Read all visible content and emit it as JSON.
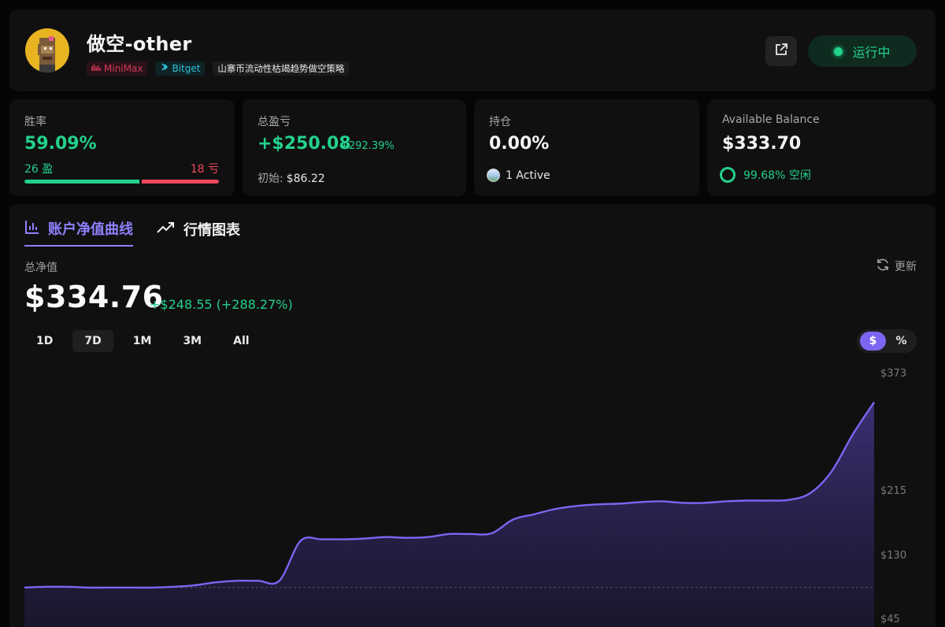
{
  "header": {
    "bot_name": "做空-other",
    "tags": {
      "model": "MiniMax",
      "exchange": "Bitget",
      "strategy": "山寨币流动性枯竭趋势做空策略"
    },
    "status_label": "运行中",
    "accent_green": "#23d18b"
  },
  "stats": {
    "winrate": {
      "label": "胜率",
      "value": "59.09%",
      "wins_label": "26 盈",
      "losses_label": "18 亏",
      "win_fraction": 0.5909
    },
    "pnl": {
      "label": "总盈亏",
      "value": "+$250.08",
      "pct": "+292.39%",
      "initial_label": "初始:",
      "initial_value": "$86.22"
    },
    "position": {
      "label": "持仓",
      "value": "0.00%",
      "active_label": "1 Active"
    },
    "balance": {
      "label": "Available Balance",
      "value": "$333.70",
      "idle_label": "99.68% 空闲"
    }
  },
  "main": {
    "tabs": [
      "账户净值曲线",
      "行情图表"
    ],
    "nav_label": "总净值",
    "refresh_label": "更新",
    "total_value": "$334.76",
    "change": "+$248.55 (+288.27%)",
    "ranges": [
      "1D",
      "7D",
      "1M",
      "3M",
      "All"
    ],
    "selected_range": "7D",
    "unit_toggle": [
      "$",
      "%"
    ],
    "unit_selected": "$",
    "accent_purple": "#7b66f2"
  },
  "chart_data": {
    "type": "area",
    "y_ticks": [
      "$373",
      "$215",
      "$130",
      "$45"
    ],
    "y_tick_values": [
      373,
      215,
      130,
      45
    ],
    "ylim": [
      45,
      373
    ],
    "baseline": 86.22,
    "grid": false,
    "x": [
      0,
      1,
      2,
      3,
      4,
      5,
      6,
      7,
      8,
      9,
      10,
      11,
      12,
      13,
      14,
      15,
      16,
      17,
      18,
      19,
      20,
      21,
      22,
      23,
      24,
      25,
      26,
      27,
      28,
      29,
      30,
      31,
      32,
      33,
      34,
      35,
      36,
      37,
      38,
      39,
      40
    ],
    "values": [
      86,
      87,
      87,
      86,
      86,
      86,
      86,
      87,
      89,
      93,
      95,
      95,
      95,
      148,
      150,
      150,
      151,
      153,
      152,
      153,
      157,
      157,
      158,
      176,
      183,
      190,
      194,
      196,
      197,
      199,
      200,
      198,
      198,
      200,
      201,
      201,
      202,
      211,
      240,
      290,
      333
    ]
  }
}
